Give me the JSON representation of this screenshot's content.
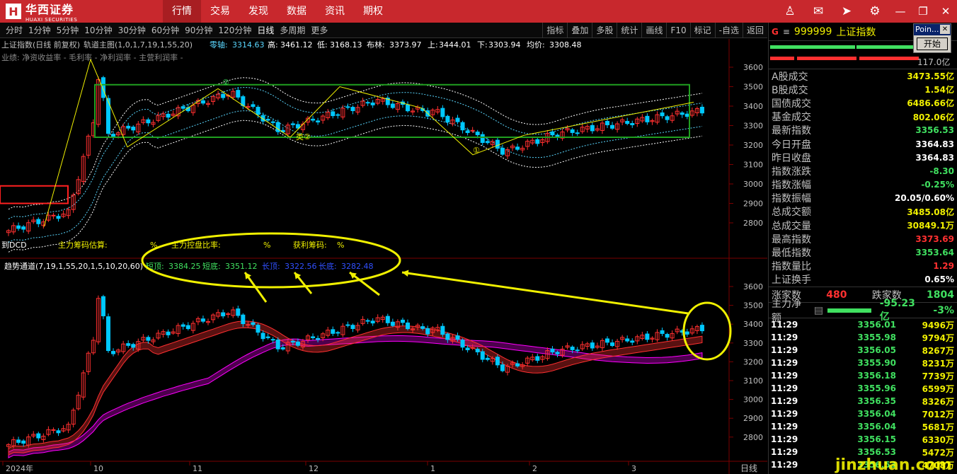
{
  "app": {
    "logo_cn": "华西证券",
    "logo_en": "HUAXI SECURITIES",
    "nav": [
      "行情",
      "交易",
      "发现",
      "数据",
      "资讯",
      "期权"
    ]
  },
  "toolbar": {
    "periods": [
      "分时",
      "1分钟",
      "5分钟",
      "10分钟",
      "30分钟",
      "60分钟",
      "90分钟",
      "120分钟",
      "日线",
      "多周期",
      "更多"
    ],
    "active_period": "日线",
    "tools": [
      "指标",
      "叠加",
      "多股",
      "统计",
      "画线",
      "F10",
      "标记",
      "-自选",
      "返回"
    ]
  },
  "chart": {
    "info_title": "上证指数(日线 前复权)",
    "info_indicator": "轨道主图(1,0,1,7,19,1,55,20)",
    "zero_axis_label": "零轴:",
    "zero_axis": "3314.63",
    "high_label": "高:",
    "high": "3461.12",
    "low_label": "低:",
    "low": "3168.13",
    "boll_label": "布林:",
    "boll": "3373.97",
    "up_label": "上:",
    "up": "3444.01",
    "down_label": "下:",
    "down": "3303.94",
    "avg_label": "均价:",
    "avg": "3308.48",
    "fin_line": "业绩: 净资收益率 - 毛利率 - 净利润率 - 主营利润率 -",
    "chip_label": "主力筹码估算:",
    "chip_pct": "%",
    "control_label": "主力控盘比率:",
    "control_pct": "%",
    "profit_label": "获利筹码:",
    "profit_pct": "%",
    "lower_title": "趋势通道(7,19,1,55,20,1,5,10,20,60)",
    "short_top_label": "短顶:",
    "short_top": "3384.25",
    "short_bottom_label": "短底:",
    "short_bottom": "3351.12",
    "long_top_label": "长顶:",
    "long_top": "3322.56",
    "long_bottom_label": "长底:",
    "long_bottom": "3282.48",
    "left_edge_label": "到DCD",
    "upper_axis": [
      "3600",
      "3500",
      "3400",
      "3300",
      "3200",
      "3100",
      "3000",
      "2900",
      "2800"
    ],
    "lower_axis": [
      "3600",
      "3500",
      "3400",
      "3300",
      "3200",
      "3100",
      "3000",
      "2900",
      "2800"
    ],
    "months": [
      "2024年",
      "10",
      "11",
      "12",
      "1",
      "2",
      "3"
    ],
    "period_tag": "日线",
    "markers": [
      "类②",
      "②",
      "①"
    ]
  },
  "quote": {
    "g": "G",
    "code": "999999",
    "name": "上证指数",
    "amount": "117.0亿",
    "stats": [
      {
        "k": "A股成交",
        "v": "3473.55亿",
        "c": "yellow"
      },
      {
        "k": "B股成交",
        "v": "1.54亿",
        "c": "yellow"
      },
      {
        "k": "国债成交",
        "v": "6486.66亿",
        "c": "yellow"
      },
      {
        "k": "基金成交",
        "v": "802.06亿",
        "c": "yellow"
      },
      {
        "k": "最新指数",
        "v": "3356.53",
        "c": "green"
      },
      {
        "k": "今日开盘",
        "v": "3364.83",
        "c": "white"
      },
      {
        "k": "昨日收盘",
        "v": "3364.83",
        "c": "white"
      },
      {
        "k": "指数涨跌",
        "v": "-8.30",
        "c": "green"
      },
      {
        "k": "指数涨幅",
        "v": "-0.25%",
        "c": "green"
      },
      {
        "k": "指数振幅",
        "v": "20.05/0.60%",
        "c": "white"
      },
      {
        "k": "总成交额",
        "v": "3485.08亿",
        "c": "yellow"
      },
      {
        "k": "总成交量",
        "v": "30849.1万",
        "c": "yellow"
      },
      {
        "k": "最高指数",
        "v": "3373.69",
        "c": "red"
      },
      {
        "k": "最低指数",
        "v": "3353.64",
        "c": "green"
      },
      {
        "k": "指数量比",
        "v": "1.29",
        "c": "red"
      },
      {
        "k": "上证换手",
        "v": "0.65%",
        "c": "white"
      }
    ],
    "up_label": "涨家数",
    "up_count": "480",
    "down_label": "跌家数",
    "down_count": "1804",
    "net_label": "主力净额",
    "net_value": "-95.23亿",
    "net_pct": "-3%",
    "ticks": [
      {
        "t": "11:29",
        "p": "3356.01",
        "v": "9496万"
      },
      {
        "t": "11:29",
        "p": "3355.98",
        "v": "9794万"
      },
      {
        "t": "11:29",
        "p": "3356.05",
        "v": "8267万"
      },
      {
        "t": "11:29",
        "p": "3355.90",
        "v": "8231万"
      },
      {
        "t": "11:29",
        "p": "3356.18",
        "v": "7739万"
      },
      {
        "t": "11:29",
        "p": "3355.96",
        "v": "6599万"
      },
      {
        "t": "11:29",
        "p": "3356.35",
        "v": "8326万"
      },
      {
        "t": "11:29",
        "p": "3356.04",
        "v": "7012万"
      },
      {
        "t": "11:29",
        "p": "3356.04",
        "v": "5681万"
      },
      {
        "t": "11:29",
        "p": "3356.15",
        "v": "6330万"
      },
      {
        "t": "11:29",
        "p": "3356.53",
        "v": "5472万"
      },
      {
        "t": "11:29",
        "p": "3356.53",
        "v": "4708万"
      }
    ]
  },
  "popup": {
    "title": "Poin...",
    "button": "开始"
  },
  "watermark": "jinzhuan.com",
  "colors": {
    "up": "#ff3030",
    "down": "#00c8ff",
    "accent": "#f0f000",
    "brand": "#c8282d"
  }
}
